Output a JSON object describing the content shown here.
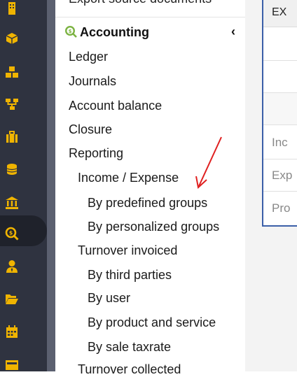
{
  "rail": {
    "icons": [
      {
        "name": "building-icon"
      },
      {
        "name": "box-icon"
      },
      {
        "name": "boxes-icon"
      },
      {
        "name": "sitemap-icon"
      },
      {
        "name": "briefcase-icon"
      },
      {
        "name": "coins-icon"
      },
      {
        "name": "bank-icon"
      },
      {
        "name": "search-dollar-icon"
      },
      {
        "name": "user-tie-icon"
      },
      {
        "name": "folder-open-icon"
      },
      {
        "name": "calendar-icon"
      },
      {
        "name": "id-card-icon"
      }
    ],
    "icon_color": "#f0b400",
    "active_index": 7
  },
  "menu": {
    "top_cut_label": "Export source documents",
    "section": {
      "label": "Accounting",
      "collapse_glyph": "‹"
    },
    "items": [
      {
        "label": "Ledger",
        "level": 1
      },
      {
        "label": "Journals",
        "level": 1
      },
      {
        "label": "Account balance",
        "level": 1
      },
      {
        "label": "Closure",
        "level": 1
      },
      {
        "label": "Reporting",
        "level": 1
      },
      {
        "label": "Income / Expense",
        "level": 2
      },
      {
        "label": "By predefined groups",
        "level": 3
      },
      {
        "label": "By personalized groups",
        "level": 3
      },
      {
        "label": "Turnover invoiced",
        "level": 2
      },
      {
        "label": "By third parties",
        "level": 3
      },
      {
        "label": "By user",
        "level": 3
      },
      {
        "label": "By product and service",
        "level": 3
      },
      {
        "label": "By sale taxrate",
        "level": 3
      },
      {
        "label": "Turnover collected",
        "level": 2
      }
    ]
  },
  "right_table": {
    "header": "EX",
    "rows": [
      "",
      "",
      "",
      "Inc",
      "Exp",
      "Pro"
    ]
  },
  "annotation": {
    "color": "#e02020"
  }
}
